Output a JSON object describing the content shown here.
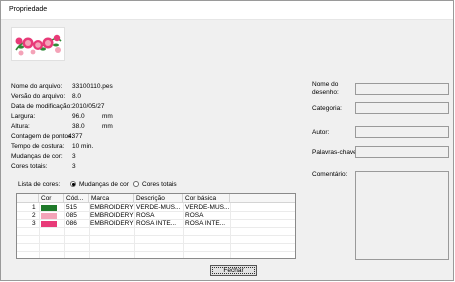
{
  "window": {
    "title": "Propriedade"
  },
  "properties": [
    {
      "label": "Nome do arquivo:",
      "value": "33100110.pes",
      "unit": ""
    },
    {
      "label": "Versão do arquivo:",
      "value": "8.0",
      "unit": ""
    },
    {
      "label": "Data de modificação:",
      "value": "2010/05/27",
      "unit": ""
    },
    {
      "label": "Largura:",
      "value": "96.0",
      "unit": "mm"
    },
    {
      "label": "Altura:",
      "value": "38.0",
      "unit": "mm"
    },
    {
      "label": "Contagem de pontos:",
      "value": "4377",
      "unit": ""
    },
    {
      "label": "Tempo de costura:",
      "value": "10  min.",
      "unit": ""
    },
    {
      "label": "Mudanças de cor:",
      "value": "3",
      "unit": ""
    },
    {
      "label": "Cores totais:",
      "value": "3",
      "unit": ""
    }
  ],
  "color_list": {
    "label": "Lista de cores:",
    "option_changes": "Mudanças de cor",
    "option_total": "Cores totais",
    "selected": "option_changes",
    "columns": [
      "Cor",
      "Cód...",
      "Marca",
      "Descrição",
      "Cor básica"
    ],
    "rows": [
      {
        "num": "1",
        "swatch": "#1f7a2a",
        "code": "515",
        "brand": "EMBROIDERY",
        "desc": "VERDE-MUS...",
        "basic": "VERDE-MUS..."
      },
      {
        "num": "2",
        "swatch": "#f4a3b8",
        "code": "085",
        "brand": "EMBROIDERY",
        "desc": "ROSA",
        "basic": "ROSA"
      },
      {
        "num": "3",
        "swatch": "#e83a78",
        "code": "086",
        "brand": "EMBROIDERY",
        "desc": "ROSA INTE...",
        "basic": "ROSA INTE..."
      }
    ]
  },
  "right_fields": {
    "nome_desenho": "Nome do\ndesenho:",
    "categoria": "Categoria:",
    "autor": "Autor:",
    "palavras_chave": "Palavras-chave:",
    "comentario": "Comentário:"
  },
  "buttons": {
    "close": "Fechar"
  }
}
